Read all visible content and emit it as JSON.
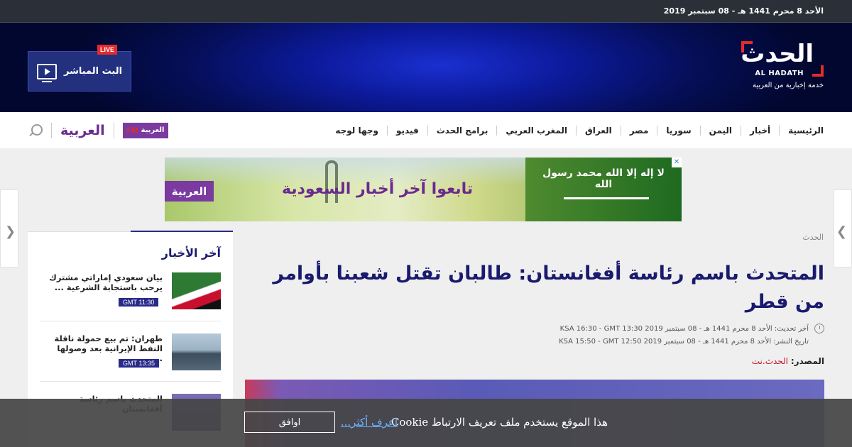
{
  "topbar": {
    "date": "الأحد 8 محرم 1441 هـ - 08 سبتمبر 2019"
  },
  "header": {
    "logo_mark": "الحدث",
    "logo_latin": "AL HADATH",
    "logo_tagline": "خدمة إخبارية من العربية",
    "live_label": "البث المباشر",
    "live_badge": "LIVE"
  },
  "nav": {
    "items": [
      {
        "label": "الرئيسية"
      },
      {
        "label": "أخبار"
      },
      {
        "label": "اليمن"
      },
      {
        "label": "سوريا"
      },
      {
        "label": "مصر"
      },
      {
        "label": "العراق"
      },
      {
        "label": "المغرب العربي"
      },
      {
        "label": "برامج الحدث"
      },
      {
        "label": "فيديو"
      },
      {
        "label": "وجها لوجه"
      }
    ],
    "brand_arabiya": "العربية",
    "brand_fm_name": "العربية",
    "brand_fm_suffix": "FM"
  },
  "ad": {
    "slogan": "تابعوا آخر أخبار السعودية",
    "logo": "العربية",
    "flag_text": "لا إله إلا الله محمد رسول الله"
  },
  "latest": {
    "heading": "آخر الأخبار",
    "items": [
      {
        "title": "بيان سعودي إماراتي مشترك يرحب باستجابة الشرعية ...",
        "time": "11:30 GMT"
      },
      {
        "title": "طهران: تم بيع حمولة ناقلة النفط الإيرانية بعد وصولها ...",
        "time": "13:35 GMT"
      },
      {
        "title": "المتحدث باسم رئاسة أفغانستان",
        "time": ""
      }
    ]
  },
  "article": {
    "section": "الحدث",
    "title": "المتحدث باسم رئاسة أفغانستان: طالبان تقتل شعبنا بأوامر من قطر",
    "updated": "آخر تحديث: الأحد 8 محرم 1441 هـ - 08 سبتمبر 2019 KSA 16:30 - GMT 13:30",
    "published": "تاريخ النشر: الأحد 8 محرم 1441 هـ - 08 سبتمبر 2019 KSA 15:50 - GMT 12:50",
    "source_label": "المصدر:",
    "source_value": "الحدث.نت"
  },
  "cookie": {
    "message": "هذا الموقع يستخدم ملف تعريف الارتباط Cookie",
    "learn_more": "اعرف أكثر...",
    "agree": "اوافق"
  },
  "colors": {
    "brand_navy": "#1a1a6e",
    "live_red": "#e32b2b",
    "arabiya_purple": "#7a3aa0",
    "source_red": "#c8102e"
  }
}
